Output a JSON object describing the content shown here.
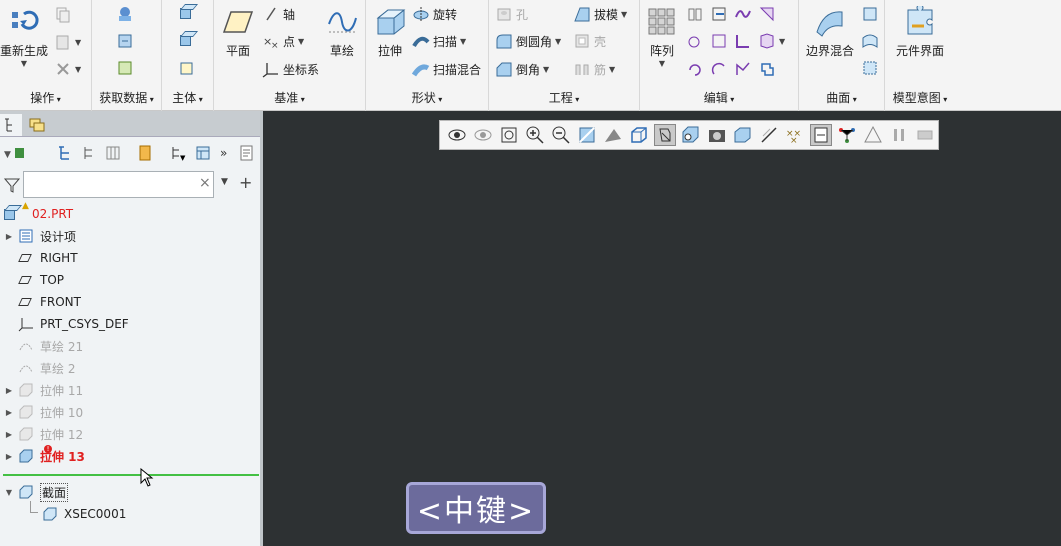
{
  "ribbon": {
    "groups": {
      "operation": {
        "label": "操作",
        "regen": "重新生成"
      },
      "getdata": {
        "label": "获取数据"
      },
      "body": {
        "label": "主体"
      },
      "datum": {
        "label": "基准",
        "plane": "平面",
        "axis": "轴",
        "point": "点",
        "csys": "坐标系",
        "sketch": "草绘"
      },
      "shapes": {
        "label": "形状",
        "extrude": "拉伸",
        "revolve": "旋转",
        "sweep": "扫描",
        "sweep_blend": "扫描混合"
      },
      "engineering": {
        "label": "工程",
        "hole": "孔",
        "round": "倒圆角",
        "chamfer": "倒角",
        "draft": "拔模",
        "shell": "壳",
        "rib": "筋"
      },
      "editing": {
        "label": "编辑",
        "pattern": "阵列"
      },
      "surfaces": {
        "label": "曲面",
        "boundary_blend": "边界混合"
      },
      "model_intent": {
        "label": "模型意图",
        "component_interface": "元件界面"
      }
    }
  },
  "tree": {
    "nodes": [
      {
        "label": "02.PRT",
        "state": "root"
      },
      {
        "label": "设计项",
        "state": "normal"
      },
      {
        "label": "RIGHT",
        "state": "normal"
      },
      {
        "label": "TOP",
        "state": "normal"
      },
      {
        "label": "FRONT",
        "state": "normal"
      },
      {
        "label": "PRT_CSYS_DEF",
        "state": "normal"
      },
      {
        "label": "草绘 21",
        "state": "dim"
      },
      {
        "label": "草绘 2",
        "state": "dim"
      },
      {
        "label": "拉伸 11",
        "state": "dim"
      },
      {
        "label": "拉伸 10",
        "state": "dim"
      },
      {
        "label": "拉伸 12",
        "state": "dim"
      },
      {
        "label": "拉伸 13",
        "state": "error"
      },
      {
        "label": "截面",
        "state": "normal"
      },
      {
        "label": "XSEC0001",
        "state": "normal"
      }
    ],
    "filter_placeholder": ""
  },
  "hint": {
    "text": "<中键>"
  },
  "colors": {
    "accent": "#6c6b9c",
    "canvas": "#2d3133",
    "error": "#e02020",
    "insert_line": "#44c044"
  }
}
